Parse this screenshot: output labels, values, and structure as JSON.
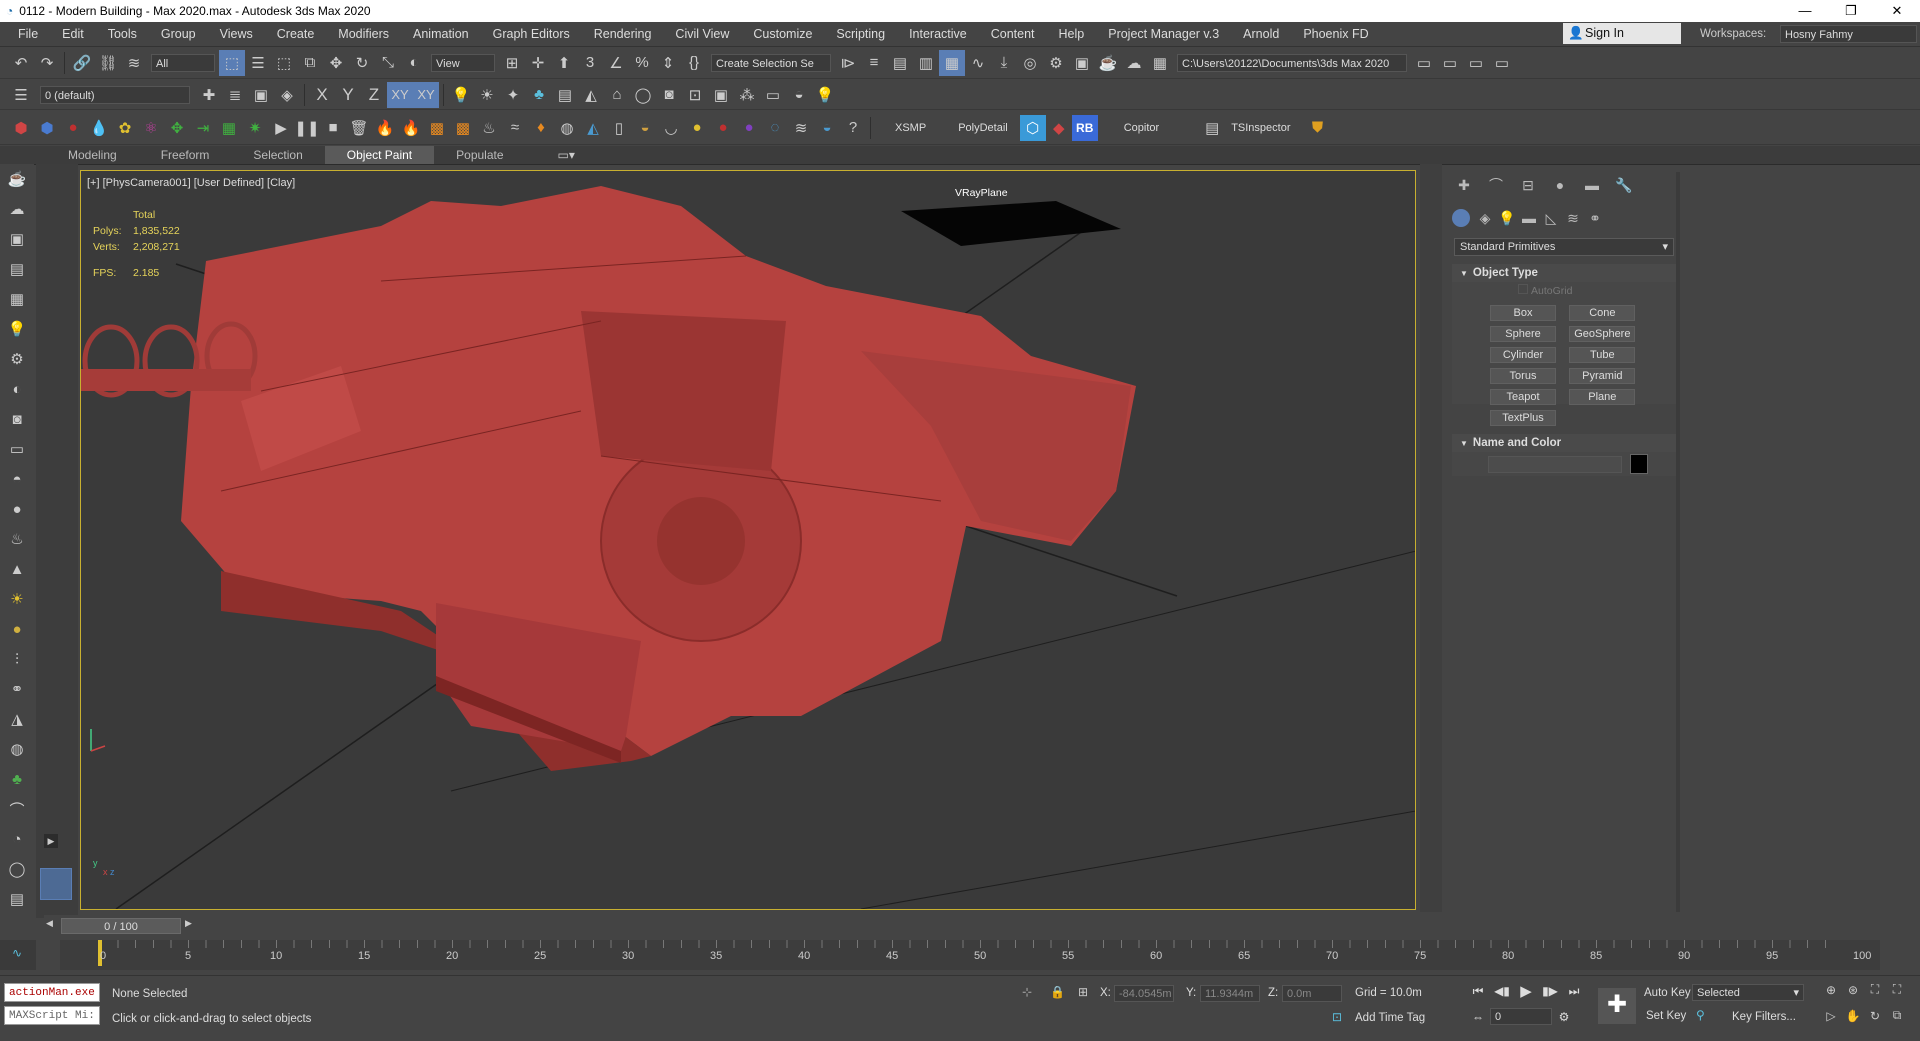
{
  "window": {
    "title": "0112 - Modern Building - Max 2020.max - Autodesk 3ds Max 2020",
    "controls": [
      "—",
      "❐",
      "✕"
    ]
  },
  "menu": [
    "File",
    "Edit",
    "Tools",
    "Group",
    "Views",
    "Create",
    "Modifiers",
    "Animation",
    "Graph Editors",
    "Rendering",
    "Civil View",
    "Customize",
    "Scripting",
    "Interactive",
    "Content",
    "Help",
    "Project Manager v.3",
    "Arnold",
    "Phoenix FD"
  ],
  "account": {
    "sign_in": "Sign In",
    "workspaces_label": "Workspaces:",
    "workspace": "Hosny Fahmy"
  },
  "toolbar1": {
    "filter": "All",
    "ref_coord": "View",
    "selection_set": "Create Selection Se",
    "project_path": "C:\\Users\\20122\\Documents\\3ds Max 2020"
  },
  "toolbar2": {
    "layer": "0 (default)",
    "axes": [
      "X",
      "Y",
      "Z",
      "XY",
      "XY"
    ]
  },
  "toolbar3": {
    "labels": [
      "XSMP",
      "PolyDetail",
      "RB",
      "Copitor",
      "TSInspector"
    ]
  },
  "ribbon": {
    "tabs": [
      "Modeling",
      "Freeform",
      "Selection",
      "Object Paint",
      "Populate"
    ],
    "active": "Object Paint"
  },
  "viewport": {
    "label": "[+] [PhysCamera001] [User Defined] [Clay]",
    "stats": {
      "total_label": "Total",
      "polys_label": "Polys:",
      "polys": "1,835,522",
      "verts_label": "Verts:",
      "verts": "2,208,271",
      "fps_label": "FPS:",
      "fps": "2.185"
    },
    "object_label": "VRayPlane",
    "axis_labels": [
      "x",
      "y",
      "z"
    ]
  },
  "command_panel": {
    "category": "Standard Primitives",
    "object_type": {
      "title": "Object Type",
      "autogrid": "AutoGrid",
      "buttons": [
        "Box",
        "Cone",
        "Sphere",
        "GeoSphere",
        "Cylinder",
        "Tube",
        "Torus",
        "Pyramid",
        "Teapot",
        "Plane",
        "TextPlus"
      ]
    },
    "name_color": {
      "title": "Name and Color",
      "name_value": "",
      "color": "#000000"
    }
  },
  "timeline": {
    "slider": "0 / 100",
    "ticks": [
      "0",
      "5",
      "10",
      "15",
      "20",
      "25",
      "30",
      "35",
      "40",
      "45",
      "50",
      "55",
      "60",
      "65",
      "70",
      "75",
      "80",
      "85",
      "90",
      "95",
      "100"
    ]
  },
  "status": {
    "listener_top": "actionMan.exe",
    "listener_bottom": "MAXScript Mi:",
    "selection": "None Selected",
    "prompt": "Click or click-and-drag to select objects",
    "x_label": "X:",
    "x": "-84.0545m",
    "y_label": "Y:",
    "y": "11.9344m",
    "z_label": "Z:",
    "z": "0.0m",
    "grid": "Grid = 10.0m",
    "add_time_tag": "Add Time Tag",
    "auto_key": "Auto Key",
    "key_mode": "Selected",
    "set_key": "Set Key",
    "key_filters": "Key Filters...",
    "frame": "0"
  },
  "colors": {
    "accent": "#5a7eb5",
    "viewport_border": "#c8b030",
    "model": "#b5423f",
    "stats": "#e5d35a"
  }
}
